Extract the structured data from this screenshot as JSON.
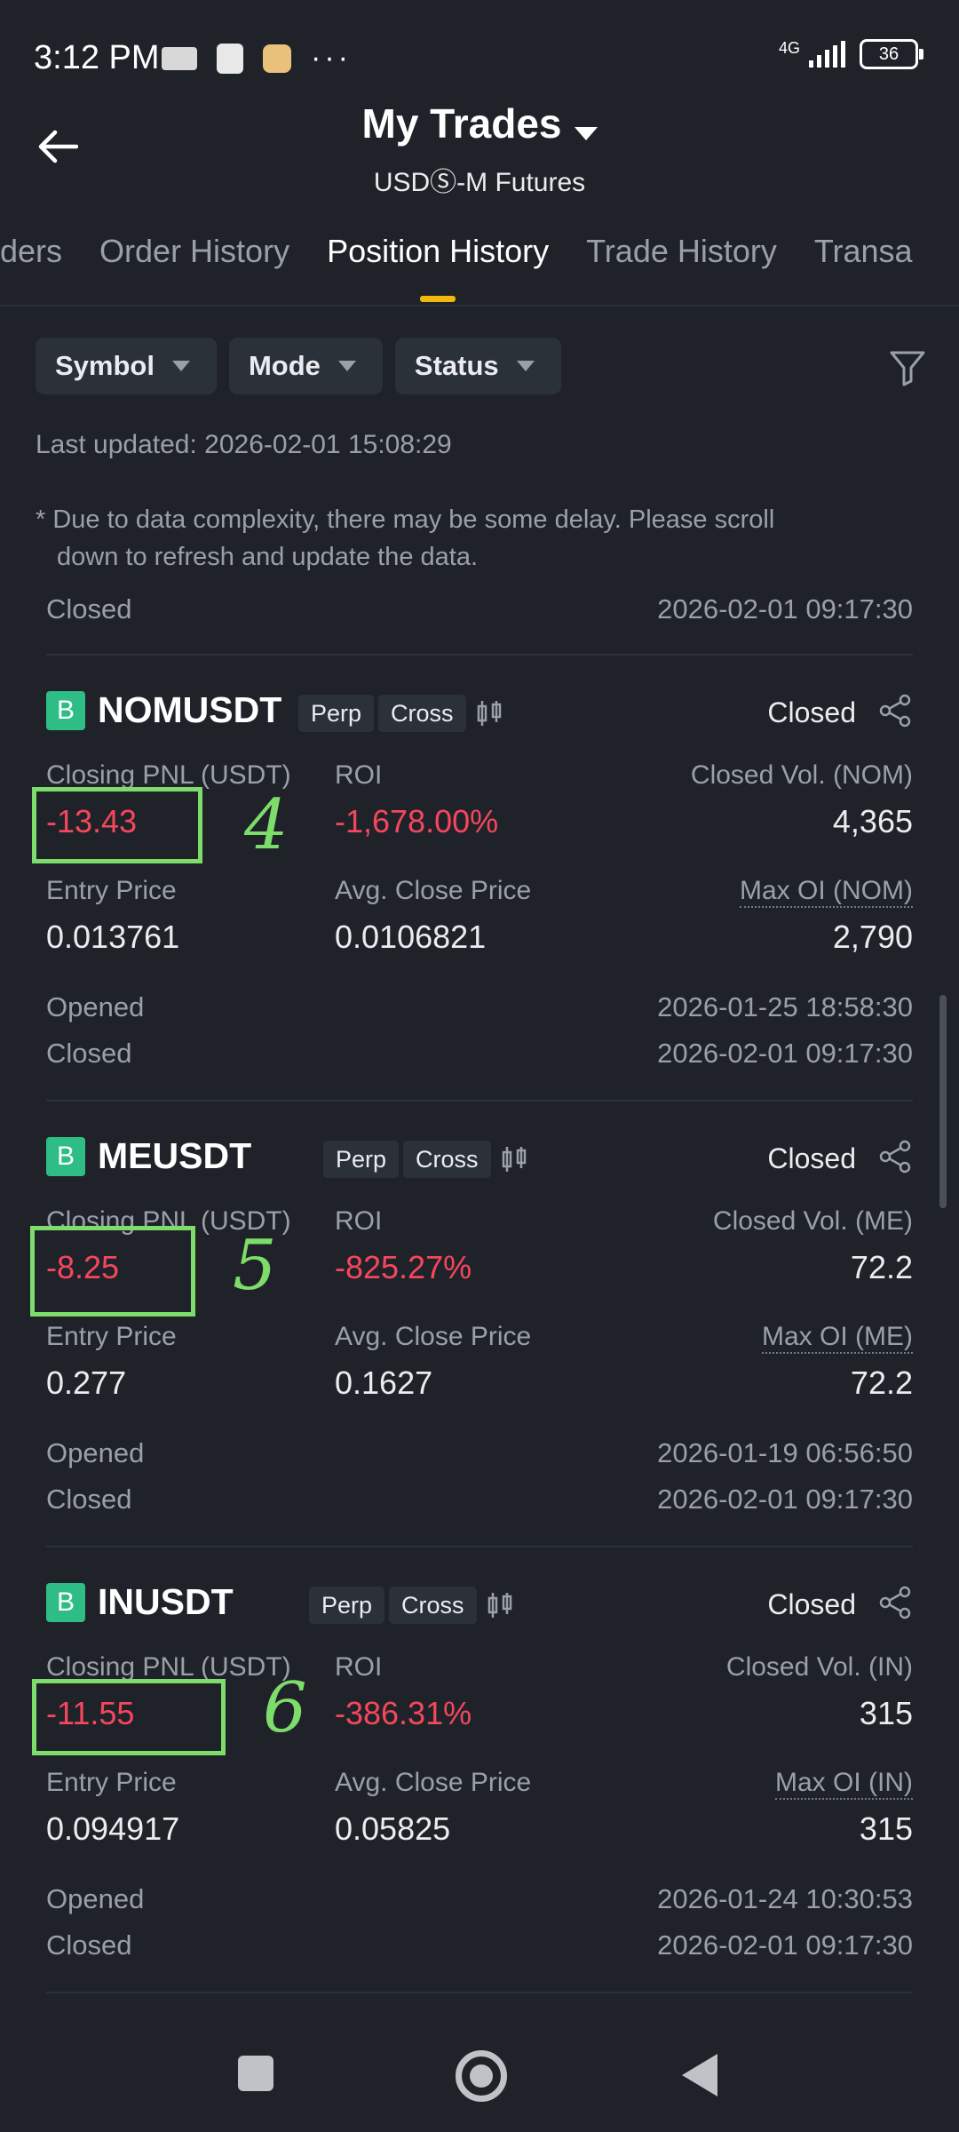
{
  "status_bar": {
    "time": "3:12 PM",
    "more": "···",
    "network": "4G",
    "battery": "36"
  },
  "header": {
    "title": "My Trades",
    "subtitle": "USDⓈ-M Futures"
  },
  "tabs": [
    {
      "label": "Orders"
    },
    {
      "label": "Order History"
    },
    {
      "label": "Position History",
      "active": true
    },
    {
      "label": "Trade History"
    },
    {
      "label": "Transa"
    }
  ],
  "filters": {
    "symbol": "Symbol",
    "mode": "Mode",
    "status": "Status"
  },
  "last_updated": "Last updated: 2026-02-01 15:08:29",
  "notice": {
    "first": "* Due to data complexity, there may be some delay. Please scroll",
    "second": "down to refresh and update the data."
  },
  "prev_card": {
    "closed_label": "Closed",
    "closed_time": "2026-02-01 09:17:30"
  },
  "labels": {
    "closing_pnl": "Closing PNL (USDT)",
    "roi": "ROI",
    "entry_price": "Entry Price",
    "avg_close_price": "Avg. Close Price",
    "opened": "Opened",
    "closed": "Closed",
    "perp": "Perp",
    "cross": "Cross",
    "status_closed": "Closed",
    "b": "B"
  },
  "positions": [
    {
      "symbol": "NOMUSDT",
      "closing_pnl": "-13.43",
      "roi": "-1,678.00%",
      "closed_vol_label": "Closed Vol. (NOM)",
      "closed_vol": "4,365",
      "entry_price": "0.013761",
      "avg_close_price": "0.0106821",
      "max_oi_label": "Max OI (NOM)",
      "max_oi": "2,790",
      "opened": "2026-01-25 18:58:30",
      "closed": "2026-02-01 09:17:30",
      "annotation": "4"
    },
    {
      "symbol": "MEUSDT",
      "closing_pnl": "-8.25",
      "roi": "-825.27%",
      "closed_vol_label": "Closed Vol. (ME)",
      "closed_vol": "72.2",
      "entry_price": "0.277",
      "avg_close_price": "0.1627",
      "max_oi_label": "Max OI (ME)",
      "max_oi": "72.2",
      "opened": "2026-01-19 06:56:50",
      "closed": "2026-02-01 09:17:30",
      "annotation": "5"
    },
    {
      "symbol": "INUSDT",
      "closing_pnl": "-11.55",
      "roi": "-386.31%",
      "closed_vol_label": "Closed Vol. (IN)",
      "closed_vol": "315",
      "entry_price": "0.094917",
      "avg_close_price": "0.05825",
      "max_oi_label": "Max OI (IN)",
      "max_oi": "315",
      "opened": "2026-01-24 10:30:53",
      "closed": "2026-02-01 09:17:30",
      "annotation": "6"
    }
  ],
  "colors": {
    "accent": "#f0b90b",
    "negative": "#f6465d",
    "positive": "#2ebd85",
    "annotation": "#7ddc6a"
  }
}
